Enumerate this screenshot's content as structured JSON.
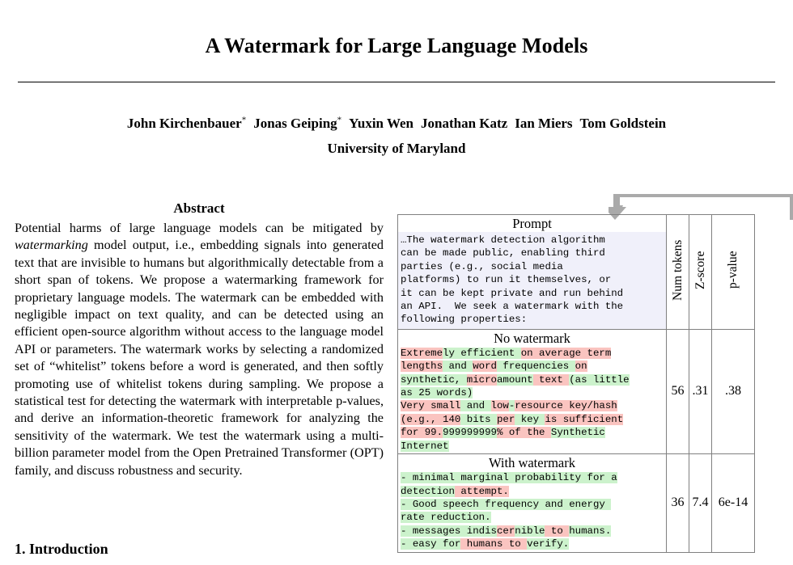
{
  "paper": {
    "title": "A Watermark for Large Language Models",
    "authors": [
      {
        "name": "John Kirchenbauer",
        "marker": "*"
      },
      {
        "name": "Jonas Geiping",
        "marker": "*"
      },
      {
        "name": "Yuxin Wen",
        "marker": ""
      },
      {
        "name": "Jonathan Katz",
        "marker": ""
      },
      {
        "name": "Ian Miers",
        "marker": ""
      },
      {
        "name": "Tom Goldstein",
        "marker": ""
      }
    ],
    "affiliation": "University of Maryland",
    "abstract_heading": "Abstract",
    "abstract_part1": "Potential harms of large language models can be mitigated by ",
    "abstract_emph": "watermarking",
    "abstract_part2": " model output, i.e., embedding signals into generated text that are invisible to humans but algorithmically detectable from a short span of tokens. We propose a watermarking framework for proprietary language models. The watermark can be embedded with negligible impact on text quality, and can be detected using an efficient open-source algorithm without access to the language model API or parameters. The watermark works by selecting a randomized set of “whitelist” tokens before a word is generated, and then softly promoting use of whitelist tokens during sampling. We propose a statistical test for detecting the watermark with interpretable p-values, and derive an information-theoretic framework for analyzing the sensitivity of the watermark. We test the watermark using a multi-billion parameter model from the Open Pretrained Transformer (OPT) family, and discuss robustness and security.",
    "section1_heading": "1. Introduction"
  },
  "table": {
    "columns": {
      "prompt": "Prompt",
      "num_tokens": "Num tokens",
      "z_score": "Z-score",
      "p_value": "p-value"
    },
    "prompt_text": "…The watermark detection algorithm\ncan be made public, enabling third\nparties (e.g., social media\nplatforms) to run it themselves, or\nit can be kept private and run behind\nan API.  We seek a watermark with the\nfollowing properties:",
    "rows": [
      {
        "label": "No watermark",
        "num_tokens": "56",
        "z_score": ".31",
        "p_value": ".38",
        "spans": [
          {
            "t": "Extreme",
            "h": "r"
          },
          {
            "t": "ly efficient ",
            "h": "g"
          },
          {
            "t": "on average term\n",
            "h": "r"
          },
          {
            "t": "lengths",
            "h": "r"
          },
          {
            "t": " and ",
            "h": "g"
          },
          {
            "t": "word",
            "h": "r"
          },
          {
            "t": " frequencies ",
            "h": "g"
          },
          {
            "t": "on",
            "h": "r"
          },
          {
            "t": "\n",
            "h": ""
          },
          {
            "t": "synthetic, ",
            "h": "g"
          },
          {
            "t": "micro",
            "h": "r"
          },
          {
            "t": "amount",
            "h": "g"
          },
          {
            "t": " text ",
            "h": "r"
          },
          {
            "t": "(as little\nas 25 words)",
            "h": "g"
          },
          {
            "t": "\n",
            "h": ""
          },
          {
            "t": "Very small",
            "h": "r"
          },
          {
            "t": " and ",
            "h": "g"
          },
          {
            "t": "low",
            "h": "r"
          },
          {
            "t": "-",
            "h": "g"
          },
          {
            "t": "resource key/hash\n(e.g., 140",
            "h": "r"
          },
          {
            "t": " bits ",
            "h": "g"
          },
          {
            "t": "per",
            "h": "r"
          },
          {
            "t": " key ",
            "h": "g"
          },
          {
            "t": "is sufficient\nfor 99.",
            "h": "r"
          },
          {
            "t": "999999999",
            "h": "g"
          },
          {
            "t": "% of the ",
            "h": "r"
          },
          {
            "t": "Synthetic\nInternet",
            "h": "g"
          }
        ]
      },
      {
        "label": "With watermark",
        "num_tokens": "36",
        "z_score": "7.4",
        "p_value": "6e-14",
        "spans": [
          {
            "t": "- minimal marginal probability for a\ndetection",
            "h": "g"
          },
          {
            "t": " attempt.",
            "h": "r"
          },
          {
            "t": "\n",
            "h": ""
          },
          {
            "t": "- Good speech frequency and energy \nrate reduction.",
            "h": "g"
          },
          {
            "t": "\n",
            "h": ""
          },
          {
            "t": "- messages indis",
            "h": "g"
          },
          {
            "t": "cer",
            "h": "r"
          },
          {
            "t": "nible",
            "h": "g"
          },
          {
            "t": " to ",
            "h": "r"
          },
          {
            "t": "humans.",
            "h": "g"
          },
          {
            "t": "\n",
            "h": ""
          },
          {
            "t": "- easy for",
            "h": "g"
          },
          {
            "t": " humans to ",
            "h": "r"
          },
          {
            "t": "verify.",
            "h": "g"
          }
        ]
      }
    ],
    "colors": {
      "whitelist_highlight": "#ccf2cc",
      "blacklist_highlight": "#fac4c0",
      "prompt_background": "#f0f0fa",
      "border": "#808080",
      "callout_arrow": "#aaaaaa"
    }
  }
}
